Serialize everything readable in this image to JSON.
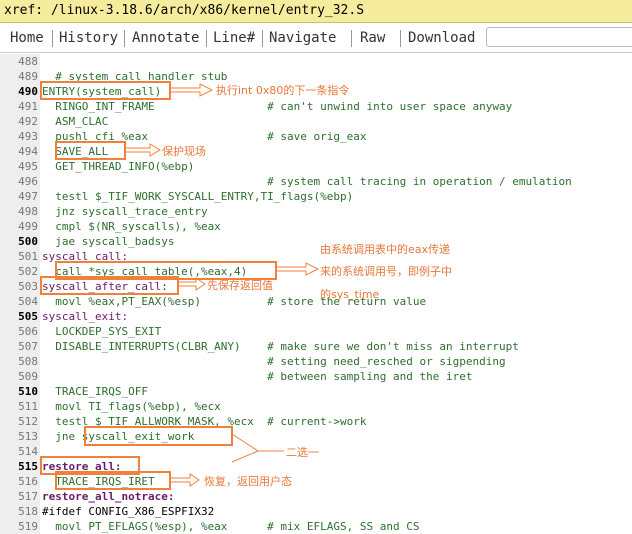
{
  "titlebar": {
    "path": "xref: /linux-3.18.6/arch/x86/kernel/entry_32.S"
  },
  "nav": {
    "items": [
      "Home",
      "History",
      "Annotate",
      "Line#",
      "Navigate",
      "Raw",
      "Download"
    ],
    "search_value": ""
  },
  "code": {
    "lines": [
      {
        "n": "488",
        "t": ""
      },
      {
        "n": "489",
        "t": "  # system_call handler stub"
      },
      {
        "n": "490",
        "t": "ENTRY(system_call)"
      },
      {
        "n": "491",
        "t": "  RINGO_INT_FRAME                 # can't unwind into user space anyway"
      },
      {
        "n": "492",
        "t": "  ASM_CLAC"
      },
      {
        "n": "493",
        "t": "  pushl_cfi %eax                  # save orig_eax"
      },
      {
        "n": "494",
        "t": "  SAVE_ALL"
      },
      {
        "n": "495",
        "t": "  GET_THREAD_INFO(%ebp)"
      },
      {
        "n": "496",
        "t": "                                  # system call tracing in operation / emulation"
      },
      {
        "n": "497",
        "t": "  testl $_TIF_WORK_SYSCALL_ENTRY,TI_flags(%ebp)"
      },
      {
        "n": "498",
        "t": "  jnz syscall_trace_entry"
      },
      {
        "n": "499",
        "t": "  cmpl $(NR_syscalls), %eax"
      },
      {
        "n": "500",
        "t": "  jae syscall_badsys"
      },
      {
        "n": "501",
        "t": "syscall_call:"
      },
      {
        "n": "502",
        "t": "  call *sys_call_table(,%eax,4)"
      },
      {
        "n": "503",
        "t": "syscall_after_call:"
      },
      {
        "n": "504",
        "t": "  movl %eax,PT_EAX(%esp)          # store the return value"
      },
      {
        "n": "505",
        "t": "syscall_exit:"
      },
      {
        "n": "506",
        "t": "  LOCKDEP_SYS_EXIT"
      },
      {
        "n": "507",
        "t": "  DISABLE_INTERRUPTS(CLBR_ANY)    # make sure we don't miss an interrupt"
      },
      {
        "n": "508",
        "t": "                                  # setting need_resched or sigpending"
      },
      {
        "n": "509",
        "t": "                                  # between sampling and the iret"
      },
      {
        "n": "510",
        "t": "  TRACE_IRQS_OFF"
      },
      {
        "n": "511",
        "t": "  movl TI_flags(%ebp), %ecx"
      },
      {
        "n": "512",
        "t": "  testl $_TIF_ALLWORK_MASK, %ecx  # current->work"
      },
      {
        "n": "513",
        "t": "  jne syscall_exit_work"
      },
      {
        "n": "514",
        "t": ""
      },
      {
        "n": "515",
        "t": "restore_all:"
      },
      {
        "n": "516",
        "t": "  TRACE_IRQS_IRET"
      },
      {
        "n": "517",
        "t": "restore_all_notrace:"
      },
      {
        "n": "518",
        "t": "#ifdef CONFIG_X86_ESPFIX32"
      },
      {
        "n": "519",
        "t": "  movl PT_EFLAGS(%esp), %eax      # mix EFLAGS, SS and CS"
      }
    ]
  },
  "annotations": {
    "a1": "执行int 0x80的下一条指令",
    "a2": "保护现场",
    "a3_1": "由系统调用表中的eax传递",
    "a3_2": "来的系统调用号，即例子中",
    "a3_3": "的sys_time",
    "a4": "先保存返回值",
    "a5": "二选一",
    "a6": "恢复，返回用户态"
  },
  "colors": {
    "annotation": "#f0803a",
    "titlebar": "#f5ed9d"
  }
}
